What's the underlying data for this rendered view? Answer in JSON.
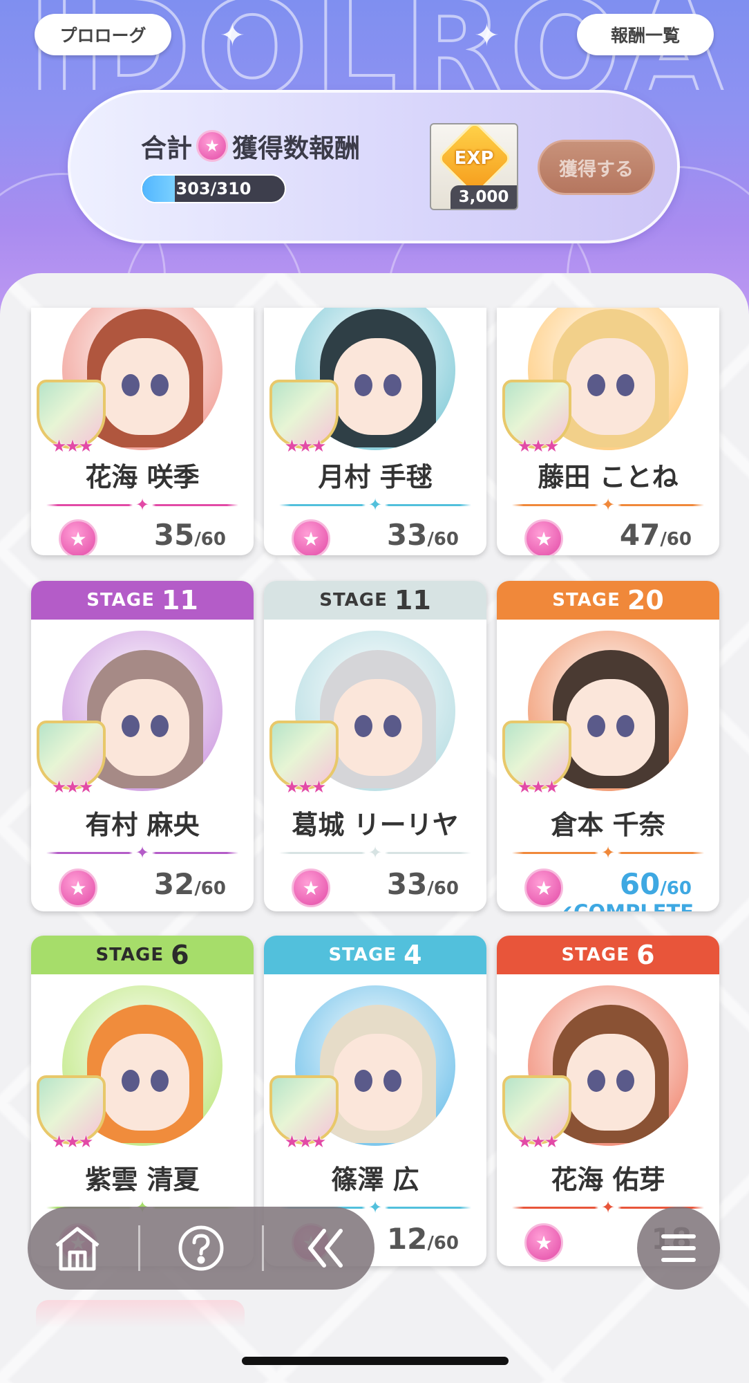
{
  "top_buttons": {
    "prologue": "プロローグ",
    "rewards_list": "報酬一覧"
  },
  "reward": {
    "title_prefix": "合計",
    "title_suffix": "獲得数報酬",
    "progress_text": "303/310",
    "exp_label": "EXP",
    "exp_amount": "3,000",
    "obtain_button": "獲得する"
  },
  "colors": {
    "purple": "#b45cc8",
    "pale_teal": "#d7e3e3",
    "orange": "#f0883a",
    "green": "#a6dd6a",
    "sky": "#52c0dc",
    "red": "#e8553a",
    "pink": "#e24aa6",
    "complete_blue": "#3ea8e2"
  },
  "cards": [
    {
      "stage_word": "",
      "stage_num": "",
      "name": "花海 咲季",
      "count": "35",
      "max": "/60",
      "complete": ""
    },
    {
      "stage_word": "",
      "stage_num": "",
      "name": "月村 手毬",
      "count": "33",
      "max": "/60",
      "complete": ""
    },
    {
      "stage_word": "",
      "stage_num": "",
      "name": "藤田 ことね",
      "count": "47",
      "max": "/60",
      "complete": ""
    },
    {
      "stage_word": "STAGE",
      "stage_num": "11",
      "name": "有村 麻央",
      "count": "32",
      "max": "/60",
      "complete": ""
    },
    {
      "stage_word": "STAGE",
      "stage_num": "11",
      "name": "葛城 リーリヤ",
      "count": "33",
      "max": "/60",
      "complete": ""
    },
    {
      "stage_word": "STAGE",
      "stage_num": "20",
      "name": "倉本 千奈",
      "count": "60",
      "max": "/60",
      "complete": "✔COMPLETE"
    },
    {
      "stage_word": "STAGE",
      "stage_num": "6",
      "name": "紫雲 清夏",
      "count": "",
      "max": "",
      "complete": ""
    },
    {
      "stage_word": "STAGE",
      "stage_num": "4",
      "name": "篠澤 広",
      "count": "12",
      "max": "/60",
      "complete": ""
    },
    {
      "stage_word": "STAGE",
      "stage_num": "6",
      "name": "花海 佑芽",
      "count": "18",
      "max": "",
      "complete": ""
    }
  ],
  "icons": {
    "home": "home-icon",
    "help": "help-icon",
    "back": "double-chevron-left-icon",
    "menu": "hamburger-menu-icon",
    "star": "star-icon"
  }
}
